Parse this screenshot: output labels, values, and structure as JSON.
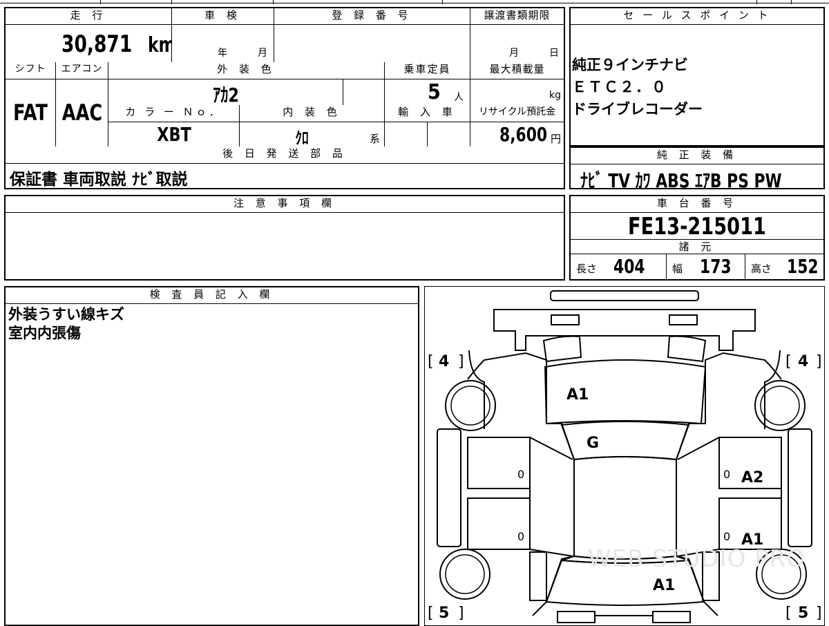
{
  "mileage": {
    "label": "走 行",
    "value": "30,871",
    "unit": "km"
  },
  "inspection": {
    "label": "車 検",
    "year": "年",
    "month": "月"
  },
  "registration": {
    "label": "登 録 番 号",
    "value": ""
  },
  "transfer": {
    "label": "譲渡書類期限",
    "month": "月",
    "day": "日"
  },
  "sales_point": {
    "label": "セ ー ル ス ポ イ ン ト",
    "lines": [
      "純正９インチナビ",
      "ＥＴＣ２．０",
      "ドライブレコーダー"
    ]
  },
  "shift": {
    "label": "シフト",
    "value": "FAT"
  },
  "aircon": {
    "label": "エアコン",
    "value": "AAC"
  },
  "exterior_color": {
    "label": "外 装 色",
    "value": "ｱｶ2"
  },
  "capacity": {
    "label": "乗車定員",
    "value": "5",
    "unit": "人"
  },
  "max_load": {
    "label": "最大積載量",
    "value": "",
    "unit": "kg"
  },
  "color_no": {
    "label": "カ ラ ー Ｎｏ．",
    "value": "XBT"
  },
  "interior_color": {
    "label": "内 装 色",
    "value": "ｸﾛ",
    "suffix": "系"
  },
  "import": {
    "label": "輸 入 車"
  },
  "recycle": {
    "label": "リサイクル預託金",
    "value": "8,600",
    "unit": "円"
  },
  "later_parts": {
    "label": "後 日 発 送 部 品",
    "value": "保証書 車両取説 ﾅﾋﾞ取説"
  },
  "genuine_equipment": {
    "label": "純 正 装 備",
    "value": "ﾅﾋﾞ TV ｶﾜ ABS ｴｱB PS PW"
  },
  "notes": {
    "label": "注 意 事 項 欄",
    "value": ""
  },
  "chassis": {
    "label": "車 台 番 号",
    "value": "FE13-215011"
  },
  "specs": {
    "label": "諸 元",
    "length_label": "長さ",
    "length": "404",
    "width_label": "幅",
    "width": "173",
    "height_label": "高さ",
    "height": "152"
  },
  "inspector": {
    "label": "検 査 員 記 入 欄",
    "lines": [
      "外装うすい線キズ",
      "室内内張傷"
    ]
  },
  "diagram": {
    "tire_front_left": "4",
    "tire_front_right": "4",
    "tire_rear_left": "5",
    "tire_rear_right": "5",
    "hood": "A1",
    "windshield": "G",
    "right_front_door": "A2",
    "right_rear_door": "A1",
    "trunk": "A1",
    "left_front_door_mark": "0",
    "left_rear_door_mark": "0",
    "right_front_door_mark": "0",
    "right_rear_door_mark": "0",
    "bracket_open": "[",
    "bracket_close": "]",
    "watermark": "WEB STUDIO PRO"
  }
}
